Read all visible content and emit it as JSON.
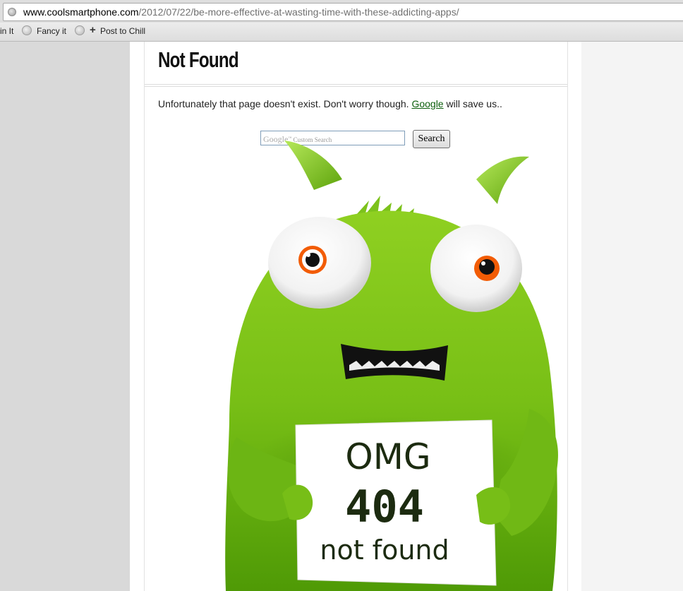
{
  "browser": {
    "url_host": "www.coolsmartphone.com",
    "url_path": "/2012/07/22/be-more-effective-at-wasting-time-with-these-addicting-apps/",
    "bookmarks": [
      {
        "label": "in It"
      },
      {
        "label": "Fancy it"
      },
      {
        "label": "Post to Chill"
      }
    ]
  },
  "page": {
    "title": "Not Found",
    "message_before": "Unfortunately that page doesn't exist. Don't worry though. ",
    "message_link": "Google",
    "message_after": " will save us..",
    "search": {
      "placeholder_brand": "Google",
      "placeholder_text": "Custom Search",
      "button_label": "Search"
    },
    "sign": {
      "line1": "OMG",
      "line2": "404",
      "line3": "not found"
    }
  },
  "colors": {
    "monster_green": "#7cc21b",
    "eye_orange": "#f25c05",
    "link_green": "#0b5e0b"
  }
}
